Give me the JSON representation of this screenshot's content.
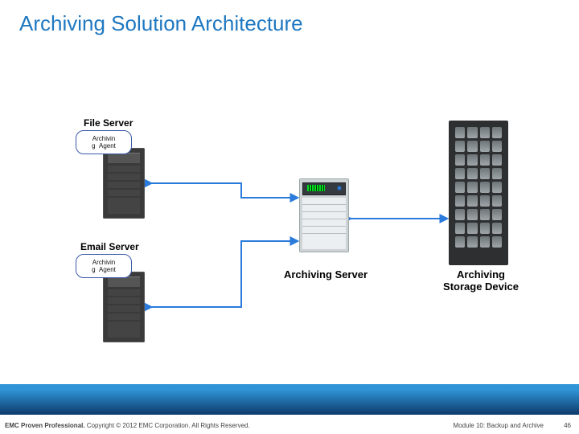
{
  "title": "Archiving Solution Architecture",
  "nodes": {
    "file_server": {
      "label": "File Server"
    },
    "email_server": {
      "label": "Email Server"
    },
    "archiving_server": {
      "label": "Archiving Server"
    },
    "storage_device": {
      "label": "Archiving\nStorage Device"
    }
  },
  "agent": {
    "line1": "Archivin",
    "line2_left": "g",
    "line2_right": "Agent"
  },
  "footer": {
    "left_bold": "EMC Proven Professional.",
    "left_rest": " Copyright © 2012 EMC Corporation. All Rights Reserved.",
    "module": "Module 10: Backup and Archive",
    "page": "46"
  },
  "colors": {
    "accent": "#1f78c1",
    "wire": "#2a7bdc"
  }
}
